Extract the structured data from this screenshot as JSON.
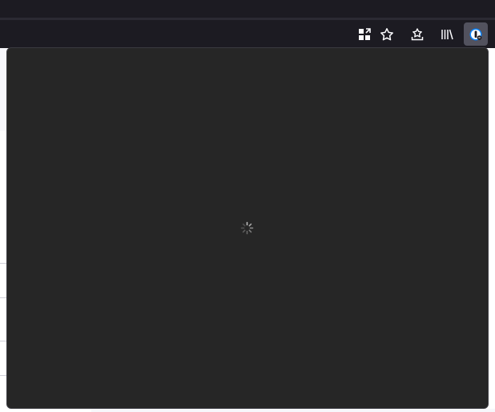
{
  "toolbar": {
    "buttons": [
      {
        "name": "extensions",
        "icon": "grid-plus-icon"
      },
      {
        "name": "bookmark-star",
        "icon": "star-icon"
      },
      {
        "name": "save-to-pocket",
        "icon": "pocket-icon"
      },
      {
        "name": "library",
        "icon": "library-icon"
      },
      {
        "name": "password-manager-extension",
        "icon": "keyhole-icon",
        "active": true
      }
    ]
  },
  "panel": {
    "state": "loading",
    "background": "#262626"
  },
  "colors": {
    "chrome": "#1c1b22",
    "active_button": "#52525e",
    "accent": "#0060df"
  }
}
